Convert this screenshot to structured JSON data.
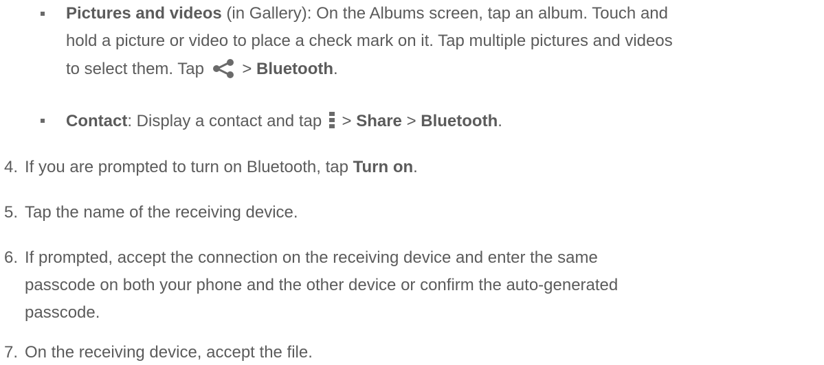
{
  "bullets": [
    {
      "bold_label": "Pictures and videos",
      "line1_rest": " (in Gallery): On the Albums screen, tap an album. Touch and",
      "line2": "hold a picture or video to place a check mark on it. Tap multiple pictures and videos",
      "line3_pre": "to select them. Tap ",
      "line3_sep": " > ",
      "line3_bold": "Bluetooth",
      "line3_end": ".",
      "icon": "share-icon"
    },
    {
      "bold_label": "Contact",
      "text_pre": ": Display a contact and tap ",
      "sep1": " > ",
      "bold_share": "Share",
      "sep2": " > ",
      "bold_bt": "Bluetooth",
      "end": ".",
      "icon": "menu-icon"
    }
  ],
  "steps": [
    {
      "num": "4.",
      "pre": "If you are prompted to turn on Bluetooth, tap ",
      "bold": "Turn on",
      "post": "."
    },
    {
      "num": "5.",
      "text": "Tap the name of the receiving device."
    },
    {
      "num": "6.",
      "lines": [
        "If prompted, accept the connection on the receiving device and enter the same",
        "passcode on both your phone and the other device or confirm the auto-generated",
        "passcode."
      ]
    },
    {
      "num": "7.",
      "text": "On the receiving device, accept the file."
    }
  ],
  "colors": {
    "text": "#5b5b5b",
    "icon": "#6a6a6a"
  }
}
